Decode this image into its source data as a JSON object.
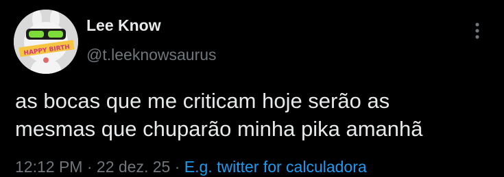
{
  "tweet": {
    "author": {
      "display_name": "Lee Know",
      "handle": "@t.leeknowsaurus",
      "avatar_text": "HAPPY BIRTH"
    },
    "more_icon": "more-vertical-icon",
    "text_lines": [
      "as bocas que me criticam hoje serão as",
      "mesmas que chuparão minha pika amanhã"
    ],
    "meta": {
      "time": "12:12 PM",
      "separator": " · ",
      "date": "22 dez. 25",
      "separator2": " · ",
      "source": "E.g. twitter for calculadora"
    },
    "colors": {
      "background": "#000000",
      "text": "#e7e9ea",
      "secondary": "#71767b",
      "link": "#1d9bf0"
    }
  }
}
